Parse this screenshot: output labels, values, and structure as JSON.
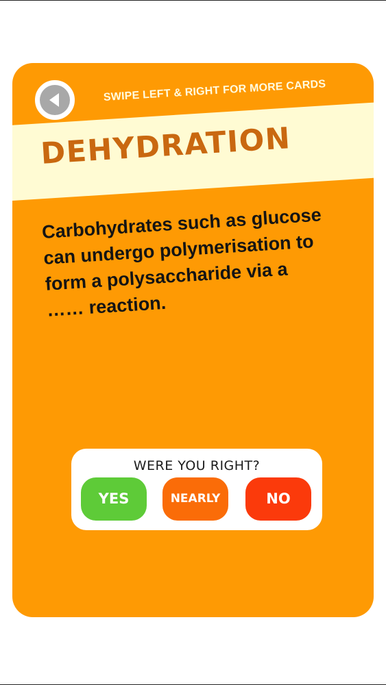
{
  "card": {
    "swipe_hint": "SWIPE LEFT & RIGHT FOR MORE CARDS",
    "title": "DEHYDRATION",
    "question_lines": [
      "Carbohydrates such as glucose",
      "can undergo polymerisation to",
      "form a polysaccharide via a",
      "…… reaction."
    ],
    "back_icon": "back-arrow-icon"
  },
  "feedback": {
    "prompt": "WERE YOU RIGHT?",
    "buttons": {
      "yes": "YES",
      "nearly": "NEARLY",
      "no": "NO"
    }
  },
  "colors": {
    "card": "#fe9a04",
    "title_band": "#fffbd3",
    "title_text": "#c96810",
    "yes": "#5ecb38",
    "nearly": "#fa6c08",
    "no": "#fb3a0b"
  }
}
